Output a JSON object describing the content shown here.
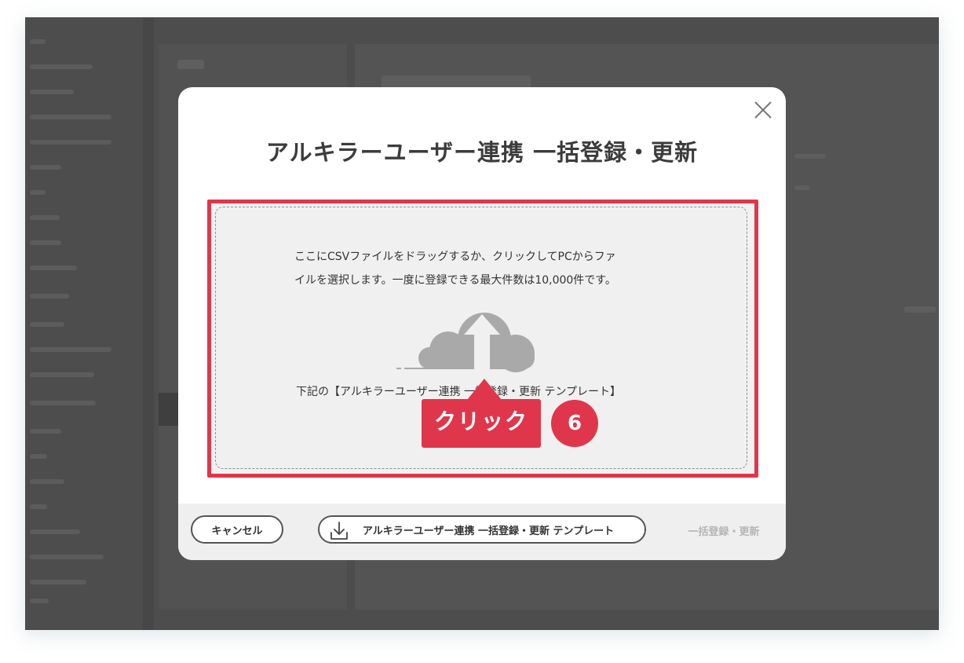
{
  "modal": {
    "title": "アルキラーユーザー連携 一括登録・更新",
    "dropzone": {
      "line1": "ここにCSVファイルをドラッグするか、クリックしてPCからファ",
      "line2": "イルを選択します。一度に登録できる最大件数は10,000件です。",
      "template_note": "下記の【アルキラーユーザー連携 一括登録・更新 テンプレート】"
    },
    "callout": {
      "label": "クリック",
      "step": "6"
    },
    "footer": {
      "cancel_label": "キャンセル",
      "template_label": "アルキラーユーザー連携 一括登録・更新 テンプレート",
      "submit_label": "一括登録・更新"
    }
  },
  "icons": [
    "close-icon",
    "cloud-upload-icon",
    "download-icon"
  ],
  "colors": {
    "accent": "#e0364b",
    "overlay": "#4d4d4d",
    "icon_gray": "#a9a9a9"
  }
}
